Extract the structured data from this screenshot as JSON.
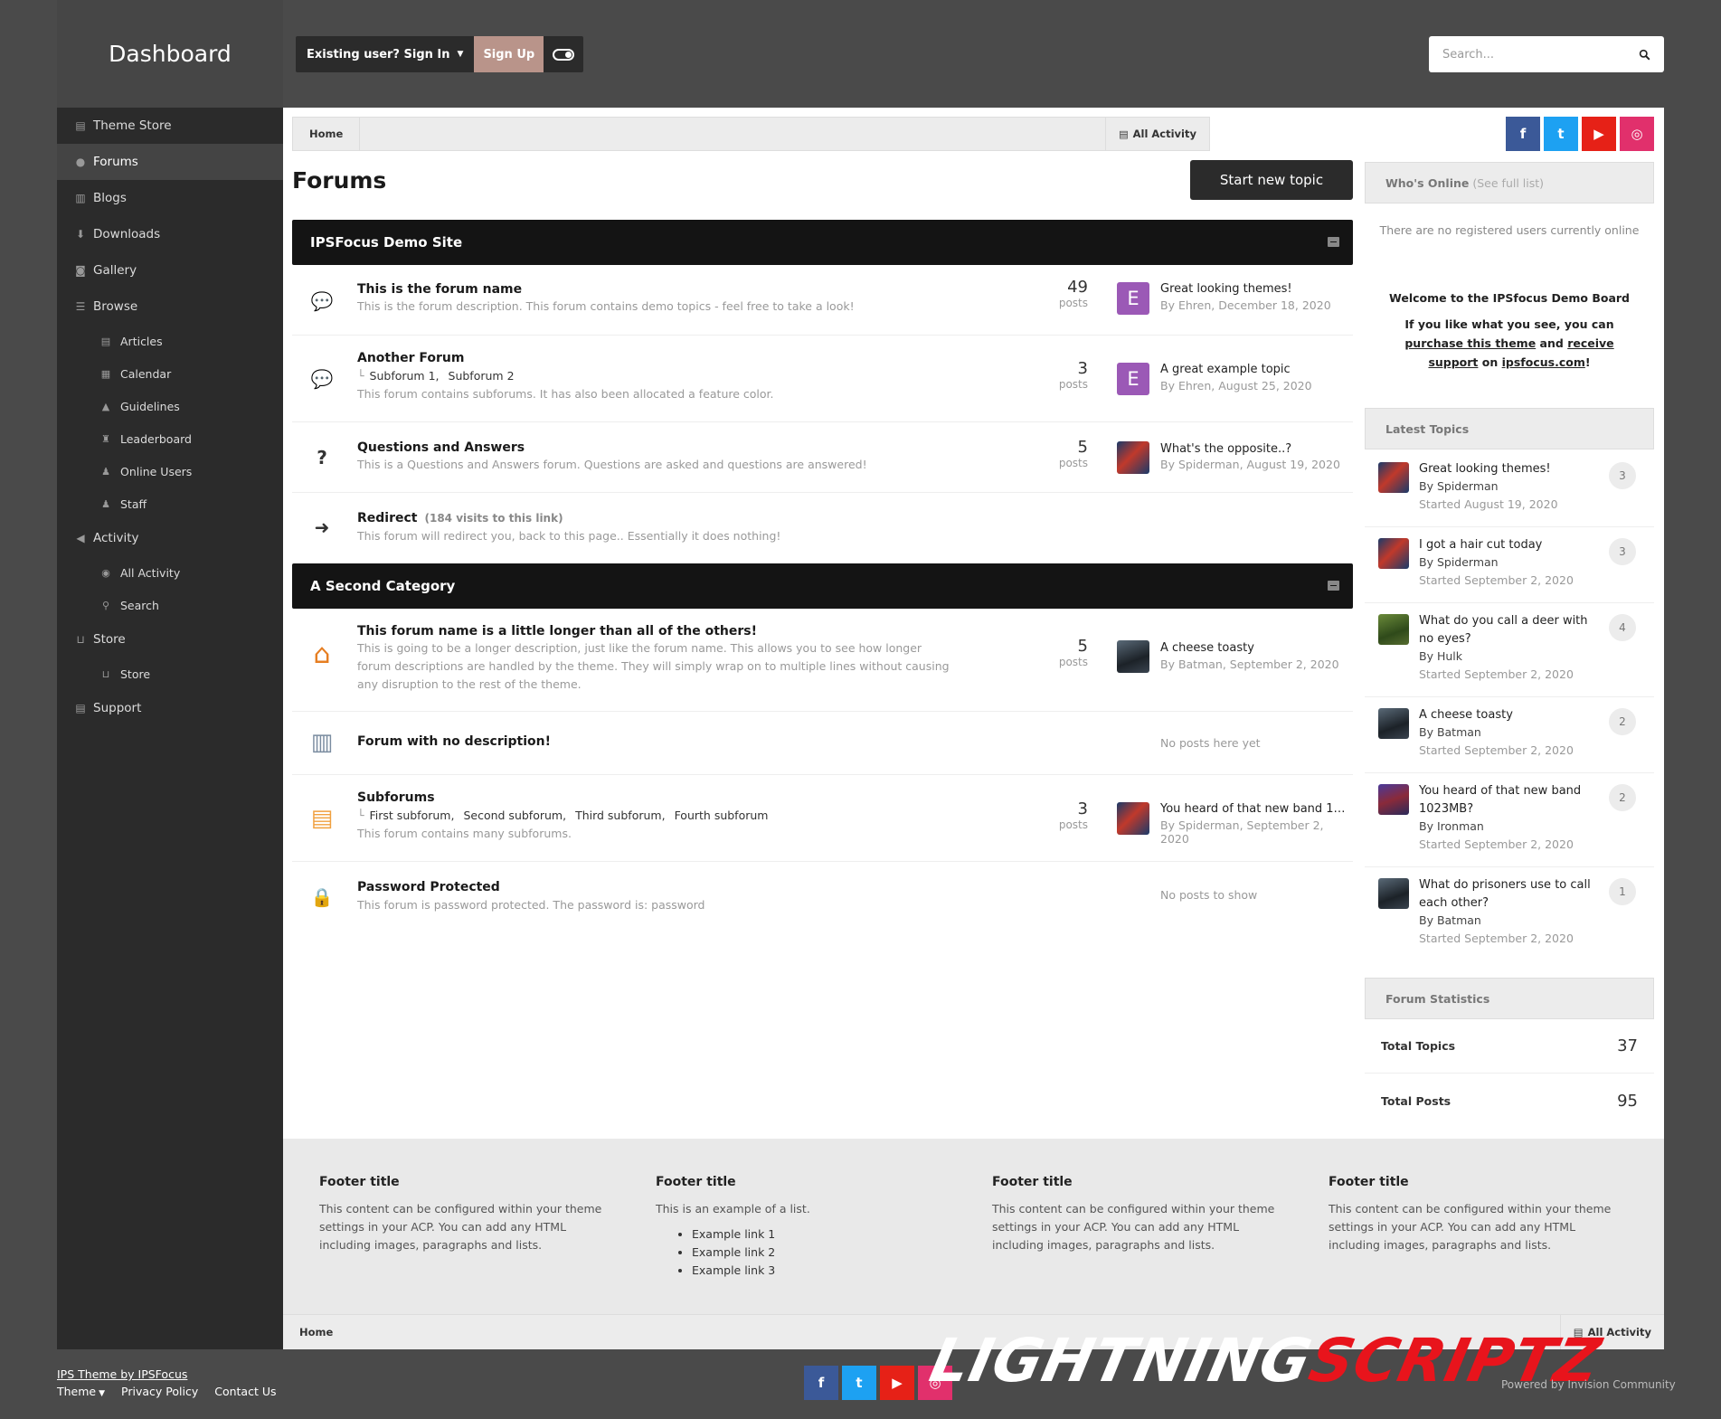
{
  "header": {
    "brand": "Dashboard",
    "signin_label": "Existing user? Sign In",
    "signup_label": "Sign Up",
    "search_placeholder": "Search..."
  },
  "sidebar": {
    "items": [
      {
        "label": "Theme Store",
        "icon": "document-icon"
      },
      {
        "label": "Forums",
        "icon": "comments-icon"
      },
      {
        "label": "Blogs",
        "icon": "book-icon"
      },
      {
        "label": "Downloads",
        "icon": "download-icon"
      },
      {
        "label": "Gallery",
        "icon": "camera-icon"
      },
      {
        "label": "Browse",
        "icon": "list-icon"
      },
      {
        "label": "Articles",
        "icon": "file-icon"
      },
      {
        "label": "Calendar",
        "icon": "calendar-icon"
      },
      {
        "label": "Guidelines",
        "icon": "warning-icon"
      },
      {
        "label": "Leaderboard",
        "icon": "trophy-icon"
      },
      {
        "label": "Online Users",
        "icon": "users-icon"
      },
      {
        "label": "Staff",
        "icon": "user-icon"
      },
      {
        "label": "Activity",
        "icon": "megaphone-icon"
      },
      {
        "label": "All Activity",
        "icon": "globe-icon"
      },
      {
        "label": "Search",
        "icon": "search-icon"
      },
      {
        "label": "Store",
        "icon": "cart-icon"
      },
      {
        "label": "Store",
        "icon": "cart-icon"
      },
      {
        "label": "Support",
        "icon": "document-icon"
      }
    ]
  },
  "breadcrumb": {
    "home": "Home",
    "all_activity": "All Activity"
  },
  "page": {
    "title": "Forums",
    "new_topic": "Start new topic"
  },
  "categories": [
    {
      "name": "IPSFocus Demo Site"
    },
    {
      "name": "A Second Category"
    }
  ],
  "forums": [
    {
      "name": "This is the forum name",
      "desc": "This is the forum description. This forum contains demo topics - feel free to take a look!",
      "count": "49",
      "count_label": "posts",
      "last_title": "Great looking themes!",
      "last_by": "By Ehren, December 18, 2020",
      "avatar_letter": "E"
    },
    {
      "name": "Another Forum",
      "subforums": [
        "Subforum 1,",
        "Subforum 2"
      ],
      "desc": "This forum contains subforums. It has also been allocated a feature color.",
      "count": "3",
      "count_label": "posts",
      "last_title": "A great example topic",
      "last_by": "By Ehren, August 25, 2020",
      "avatar_letter": "E"
    },
    {
      "name": "Questions and Answers",
      "desc": "This is a Questions and Answers forum. Questions are asked and questions are answered!",
      "count": "5",
      "count_label": "posts",
      "last_title": "What's the opposite..?",
      "last_by": "By Spiderman, August 19, 2020"
    },
    {
      "name": "Redirect",
      "visits": "(184 visits to this link)",
      "desc": "This forum will redirect you, back to this page.. Essentially it does nothing!"
    },
    {
      "name": "This forum name is a little longer than all of the others!",
      "desc": "This is going to be a longer description, just like the forum name. This allows you to see how longer forum descriptions are handled by the theme. They will simply wrap on to multiple lines without causing any disruption to the rest of the theme.",
      "count": "5",
      "count_label": "posts",
      "last_title": "A cheese toasty",
      "last_by": "By Batman, September 2, 2020"
    },
    {
      "name": "Forum with no description!",
      "nopost": "No posts here yet"
    },
    {
      "name": "Subforums",
      "subforums": [
        "First subforum,",
        "Second subforum,",
        "Third subforum,",
        "Fourth subforum"
      ],
      "desc": "This forum contains many subforums.",
      "count": "3",
      "count_label": "posts",
      "last_title": "You heard of that new band 1…",
      "last_by": "By Spiderman, September 2, 2020"
    },
    {
      "name": "Password Protected",
      "desc": "This forum is password protected. The password is: password",
      "nopost": "No posts to show"
    }
  ],
  "whos_online": {
    "title": "Who's Online",
    "sub": "(See full list)",
    "text": "There are no registered users currently online"
  },
  "welcome": {
    "line1": "Welcome to the IPSfocus Demo Board",
    "line2a": "If you like what you see, you can",
    "link1": "purchase this theme",
    "and": "and",
    "link2": "receive support",
    "on": "on",
    "link3": "ipsfocus.com",
    "end": "!"
  },
  "latest_topics": {
    "title": "Latest Topics",
    "items": [
      {
        "title": "Great looking themes!",
        "by": "By Spiderman",
        "started": "Started August 19, 2020",
        "count": "3"
      },
      {
        "title": "I got a hair cut today",
        "by": "By Spiderman",
        "started": "Started September 2, 2020",
        "count": "3"
      },
      {
        "title": "What do you call a deer with no eyes?",
        "by": "By Hulk",
        "started": "Started September 2, 2020",
        "count": "4"
      },
      {
        "title": "A cheese toasty",
        "by": "By Batman",
        "started": "Started September 2, 2020",
        "count": "2"
      },
      {
        "title": "You heard of that new band 1023MB?",
        "by": "By Ironman",
        "started": "Started September 2, 2020",
        "count": "2"
      },
      {
        "title": "What do prisoners use to call each other?",
        "by": "By Batman",
        "started": "Started September 2, 2020",
        "count": "1"
      }
    ]
  },
  "stats": {
    "title": "Forum Statistics",
    "topics_label": "Total Topics",
    "topics": "37",
    "posts_label": "Total Posts",
    "posts": "95"
  },
  "footer": {
    "cols": [
      {
        "title": "Footer title",
        "text": "This content can be configured within your theme settings in your ACP. You can add any HTML including images, paragraphs and lists."
      },
      {
        "title": "Footer title",
        "text": "This is an example of a list.",
        "list": [
          "Example link 1",
          "Example link 2",
          "Example link 3"
        ]
      },
      {
        "title": "Footer title",
        "text": "This content can be configured within your theme settings in your ACP. You can add any HTML including images, paragraphs and lists."
      },
      {
        "title": "Footer title",
        "text": "This content can be configured within your theme settings in your ACP. You can add any HTML including images, paragraphs and lists."
      }
    ],
    "theme_by": "IPS Theme by IPSFocus",
    "theme": "Theme",
    "privacy": "Privacy Policy",
    "contact": "Contact Us",
    "powered": "Powered by Invision Community"
  },
  "watermark": {
    "part1": "LIGHTNING",
    "part2": "SCRIPTZ"
  },
  "colors": {
    "dark": "#2b2b2b",
    "signup": "#b9948a",
    "facebook": "#3b5998",
    "twitter": "#1da1f2",
    "youtube": "#e62117",
    "instagram": "#e1306c",
    "watermark_red": "#e8141c"
  }
}
